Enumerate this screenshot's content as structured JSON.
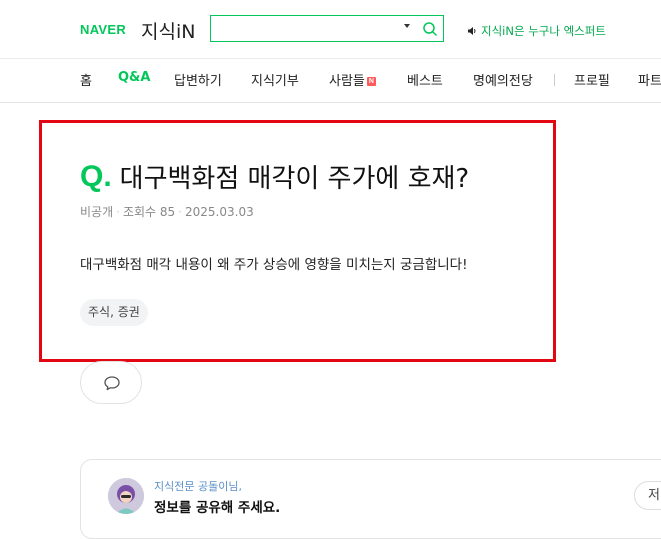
{
  "header": {
    "logo_naver": "NAVER",
    "logo_kin": "지식iN",
    "search": {
      "value": "",
      "placeholder": ""
    },
    "expert_text": "지식iN은 누구나 엑스퍼트"
  },
  "nav": {
    "items": [
      {
        "label": "홈"
      },
      {
        "label": "Q&A",
        "active": true
      },
      {
        "label": "답변하기"
      },
      {
        "label": "지식기부"
      },
      {
        "label": "사람들",
        "badge": "N"
      },
      {
        "label": "베스트"
      },
      {
        "label": "명예의전당"
      },
      {
        "label": "프로필"
      },
      {
        "label": "파트"
      }
    ]
  },
  "question": {
    "q_mark": "Q.",
    "title": "대구백화점 매각이 주가에 호재?",
    "author": "비공개",
    "views": "조회수 85",
    "date": "2025.03.03",
    "content": "대구백화점 매각 내용이 왜 주가 상승에 영향을 미치는지 궁금합니다!",
    "tag": "주식, 증권"
  },
  "answer": {
    "subtitle": "지식전문 공돌이님,",
    "title": "정보를 공유해 주세요.",
    "right_button": "저"
  },
  "colors": {
    "brand_green": "#03c75a",
    "highlight_red": "#e30613"
  }
}
